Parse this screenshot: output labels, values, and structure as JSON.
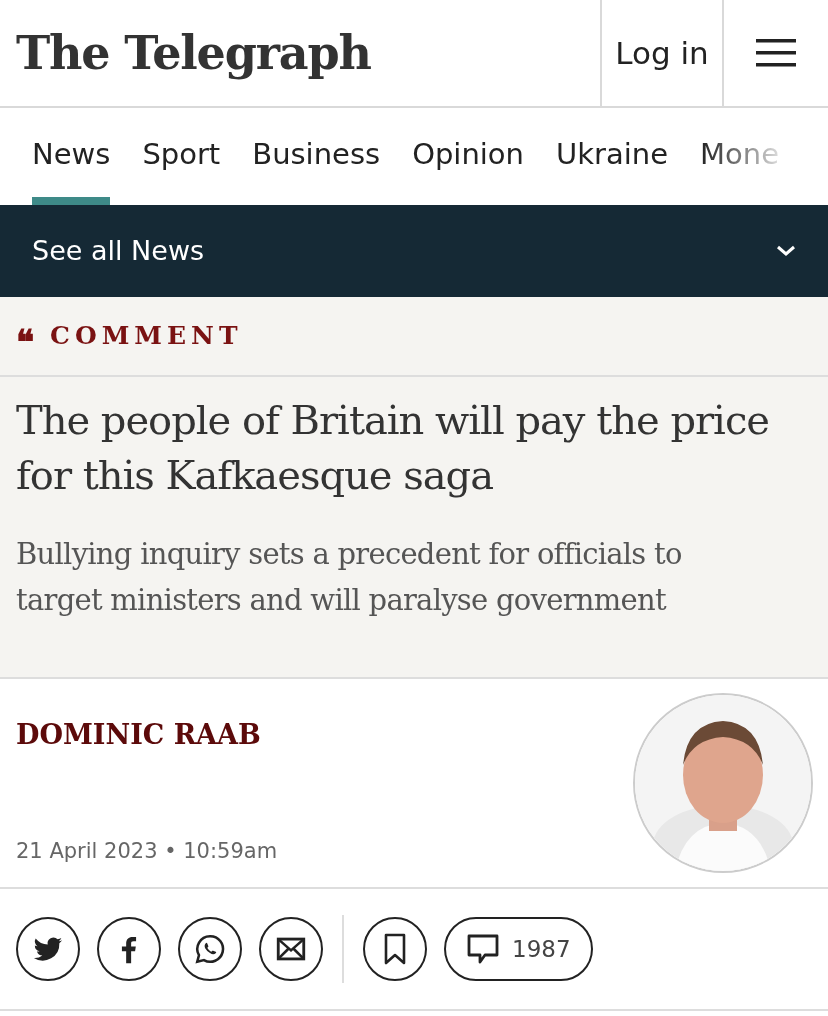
{
  "header": {
    "logo": "The Telegraph",
    "login": "Log in"
  },
  "nav": {
    "tabs": [
      {
        "label": "News",
        "selected": true
      },
      {
        "label": "Sport",
        "selected": false
      },
      {
        "label": "Business",
        "selected": false
      },
      {
        "label": "Opinion",
        "selected": false
      },
      {
        "label": "Ukraine",
        "selected": false
      },
      {
        "label": "Mone",
        "selected": false
      }
    ],
    "section_dropdown": "See all News"
  },
  "article": {
    "kicker_icon": "❝",
    "kicker": "COMMENT",
    "headline": "The people of Britain will pay the price for this Kafkaesque saga",
    "standfirst": "Bullying inquiry sets a precedent for officials to target ministers and will paralyse government",
    "author": "DOMINIC RAAB",
    "date": "21 April 2023 • 10:59am"
  },
  "share": {
    "comment_count": "1987"
  }
}
